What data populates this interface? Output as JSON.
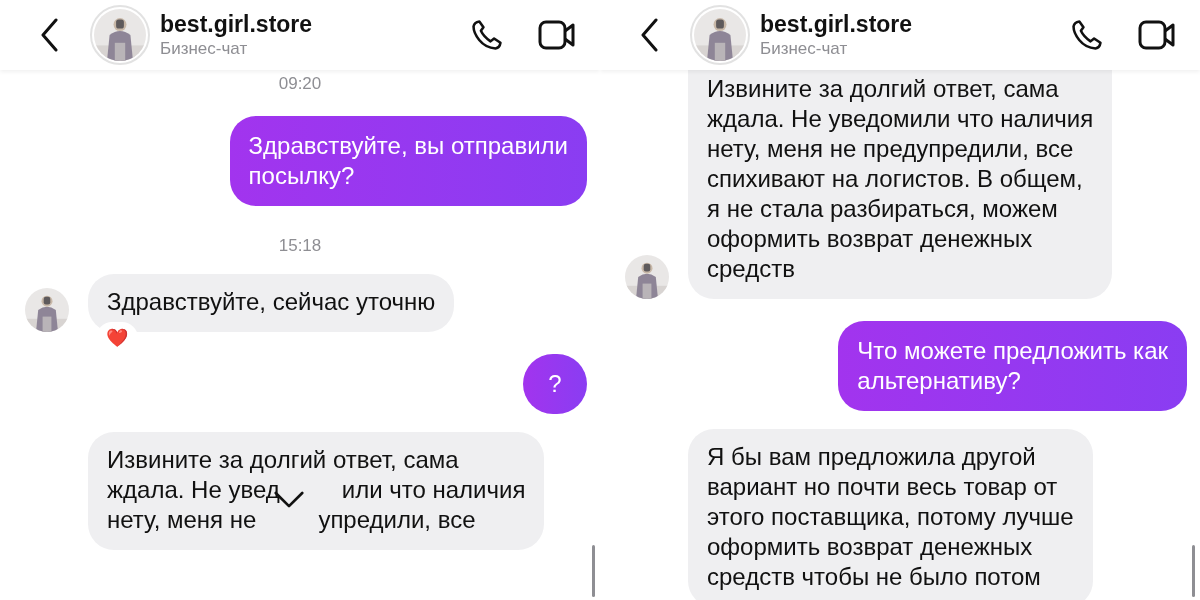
{
  "panels": [
    {
      "header": {
        "name": "best.girl.store",
        "subtitle": "Бизнес-чат"
      },
      "scroll_down_button": true,
      "items": [
        {
          "kind": "time",
          "text": "09:20"
        },
        {
          "kind": "outgoing",
          "lines": [
            [
              "Здравствуйте, вы отправили"
            ],
            [
              "посылку?"
            ]
          ]
        },
        {
          "kind": "time",
          "text": "15:18"
        },
        {
          "kind": "incoming",
          "avatar": true,
          "reaction": "❤️",
          "lines": [
            [
              "Здравствуйте, сейчас уточню"
            ]
          ]
        },
        {
          "kind": "outgoing",
          "lines": [
            [
              "?"
            ]
          ]
        },
        {
          "kind": "incoming",
          "avatar": false,
          "lines": [
            [
              "Извините за долгий ответ, сама"
            ],
            [
              "ждала. Не увед",
              "или что наличия"
            ],
            [
              "нету, меня не",
              "упредили, все"
            ]
          ]
        }
      ]
    },
    {
      "header": {
        "name": "best.girl.store",
        "subtitle": "Бизнес-чат"
      },
      "scroll_down_button": false,
      "items": [
        {
          "kind": "incoming",
          "avatar": true,
          "lines": [
            [
              "Извините за долгий ответ, сама"
            ],
            [
              "ждала. Не уведомили что наличия"
            ],
            [
              "нету, меня не предупредили, все"
            ],
            [
              "спихивают на логистов. В общем,"
            ],
            [
              "я не стала разбираться, можем"
            ],
            [
              "оформить возврат денежных"
            ],
            [
              "средств"
            ]
          ]
        },
        {
          "kind": "outgoing",
          "lines": [
            [
              "Что можете предложить как"
            ],
            [
              "альтернативу?"
            ]
          ]
        },
        {
          "kind": "incoming",
          "avatar": false,
          "lines": [
            [
              "Я бы вам предложила другой"
            ],
            [
              "вариант но почти весь товар от"
            ],
            [
              "этого поставщика, потому лучше"
            ],
            [
              "оформить возврат денежных"
            ],
            [
              "средств чтобы не было потом"
            ]
          ]
        }
      ]
    }
  ]
}
